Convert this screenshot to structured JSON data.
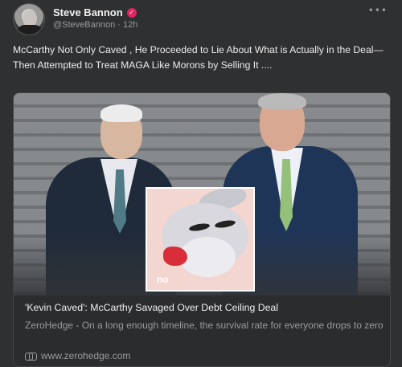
{
  "post": {
    "author_name": "Steve Bannon",
    "verified_badge": "✓",
    "handle": "@SteveBannon",
    "separator": "·",
    "time": "12h",
    "menu_glyph": "•••",
    "text": "McCarthy Not Only Caved , He Proceeded to Lie About What is Actually in the Deal—Then Attempted to Treat MAGA Like Morons by Selling It ...."
  },
  "card": {
    "meme_caption": "no",
    "title": "'Kevin Caved': McCarthy Savaged Over Debt Ceiling Deal",
    "description": "ZeroHedge - On a long enough timeline, the survival rate for everyone drops to zero",
    "link_text": "www.zerohedge.com"
  },
  "colors": {
    "background": "#2f3032",
    "verified_badge": "#e0245e",
    "primary_text": "#ececec",
    "secondary_text": "#9b9b9b"
  }
}
